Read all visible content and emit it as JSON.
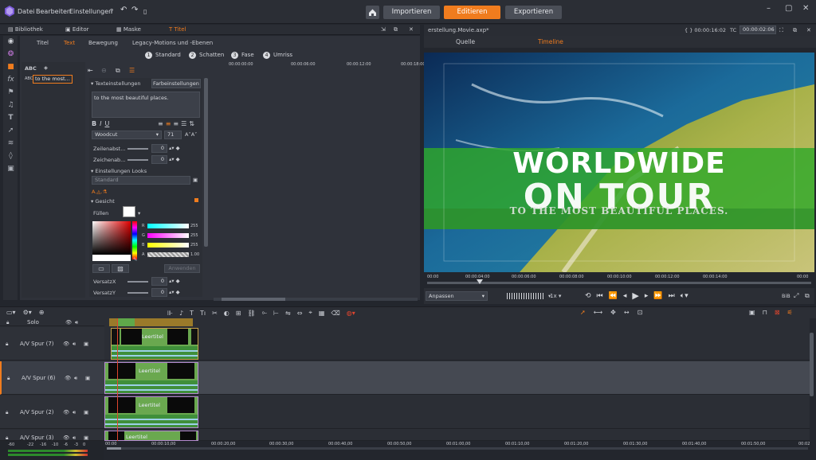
{
  "menu": {
    "items": [
      "Datei",
      "Bearbeiten",
      "Einstellungen"
    ]
  },
  "nav": {
    "import": "Importieren",
    "edit": "Editieren",
    "export": "Exportieren"
  },
  "left_tabs": {
    "library": "Bibliothek",
    "editor": "Editor",
    "mask": "Maske",
    "title": "Titel"
  },
  "text_tabs": [
    "Titel",
    "Text",
    "Bewegung",
    "Legacy-Motions und -Ebenen"
  ],
  "presets": [
    {
      "num": "1",
      "label": "Standard"
    },
    {
      "num": "2",
      "label": "Schatten"
    },
    {
      "num": "3",
      "label": "Fase"
    },
    {
      "num": "4",
      "label": "Umriss"
    }
  ],
  "objects": {
    "abc": "ABC",
    "abc_small": "ABC",
    "text_item": "to the most..."
  },
  "ruler_left": [
    "00:00:00:00",
    "00:00:06:00",
    "00:00:12:00",
    "00:00:18:00"
  ],
  "props": {
    "text_settings": "Texteinstellungen",
    "color_settings": "Farbeinstellungen",
    "text_value": "to the most beautiful places.",
    "font": "Woodcut",
    "size": "71",
    "text_size_hint": "A˄A˅",
    "line_spacing_label": "Zeilenabst...",
    "line_spacing": "0",
    "char_spacing_label": "Zeichenab...",
    "char_spacing": "0",
    "looks_label": "Einstellungen Looks",
    "looks_value": "Standard",
    "face_label": "Gesicht",
    "fill_label": "Füllen",
    "rgb": [
      {
        "ch": "R",
        "val": "255"
      },
      {
        "ch": "G",
        "val": "255"
      },
      {
        "ch": "B",
        "val": "255"
      },
      {
        "ch": "A",
        "val": "1.00"
      }
    ],
    "apply": "Anwenden",
    "offset_x_label": "VersatzX",
    "offset_x": "0",
    "offset_y_label": "VersatzY",
    "offset_y": "0"
  },
  "preview": {
    "filename": "erstellung.Movie.axp*",
    "timecode_left": "00:00:16:02",
    "tc_label": "TC",
    "timecode_right": "00:00:02:06",
    "tab_source": "Quelle",
    "tab_timeline": "Timeline",
    "title_line1": "WORLDWIDE",
    "title_line2": "ON TOUR",
    "title_line3": "TO THE MOST BEAUTIFUL PLACES.",
    "ruler": [
      "00:00",
      "00:00:04:00",
      "00:00:06:00",
      "00:00:08:00",
      "00:00:10:00",
      "00:00:12:00",
      "00:00:14:00",
      "00:00"
    ],
    "fit": "Anpassen",
    "speed": "1x",
    "bib": "BiB"
  },
  "tracks": [
    {
      "name": "Solo"
    },
    {
      "name": "A/V Spur (7)",
      "clip": "Leertitel"
    },
    {
      "name": "A/V Spur (6)",
      "clip": "Leertitel"
    },
    {
      "name": "A/V Spur (2)",
      "clip": "Leertitel"
    },
    {
      "name": "A/V Spur (3)",
      "clip": "Leertitel"
    }
  ],
  "tl_ruler": [
    "00:00",
    "00:00:10,00",
    "00:00:20,00",
    "00:00:30,00",
    "00:00:40,00",
    "00:00:50,00",
    "00:01:00,00",
    "00:01:10,00",
    "00:01:20,00",
    "00:01:30,00",
    "00:01:40,00",
    "00:01:50,00",
    "00:02"
  ],
  "meter": [
    "-60",
    "-22",
    "-16",
    "-10",
    "-6",
    "-3",
    "0"
  ],
  "colors": {
    "accent": "#f07c1e",
    "clip_green": "#6aa84f",
    "clip_green_light": "#8dc06a",
    "clip_band": "#3f8f3a"
  }
}
